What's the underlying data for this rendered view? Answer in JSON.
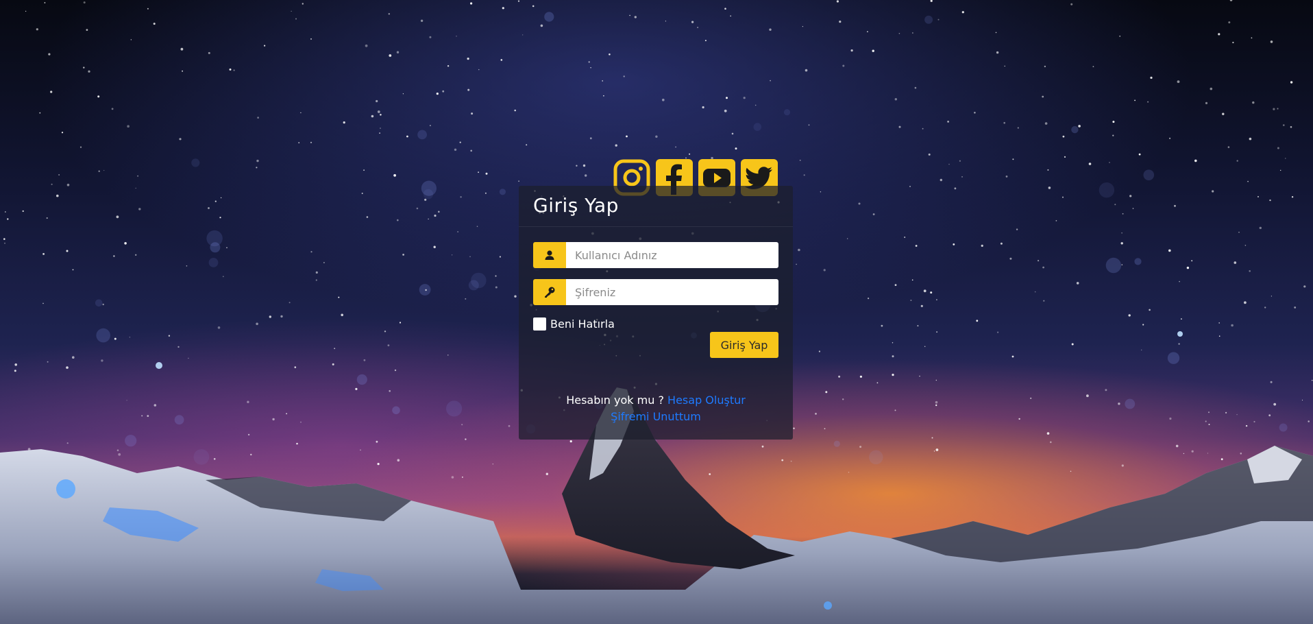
{
  "login": {
    "title": "Giriş Yap",
    "username_placeholder": "Kullanıcı Adınız",
    "password_placeholder": "Şifreniz",
    "remember_label": "Beni Hatırla",
    "submit_label": "Giriş Yap",
    "no_account_text": "Hesabın yok mu ?",
    "create_account_link": "Hesap Oluştur",
    "forgot_password_link": "Şifremi Unuttum"
  },
  "social": {
    "icons": [
      "instagram-icon",
      "facebook-icon",
      "youtube-icon",
      "twitter-icon"
    ]
  },
  "colors": {
    "accent": "#f7c51a",
    "link": "#1e7bff",
    "panel": "#1c1e2c"
  },
  "background": {
    "description_icon": "mountain-night-sky-background"
  }
}
